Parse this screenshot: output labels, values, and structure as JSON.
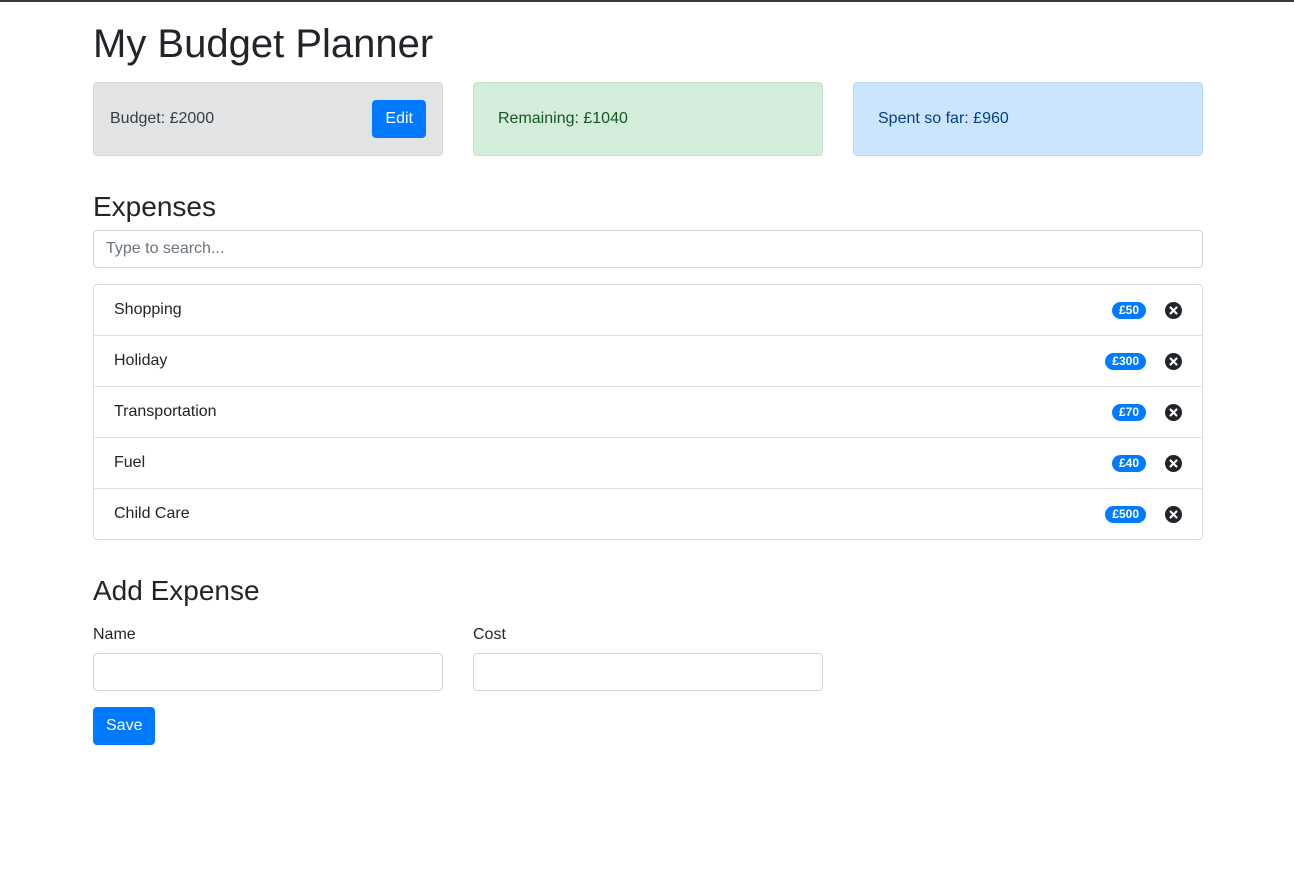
{
  "page_title": "My Budget Planner",
  "budget": {
    "label": "Budget: £2000",
    "edit_label": "Edit"
  },
  "remaining": {
    "label": "Remaining: £1040"
  },
  "spent": {
    "label": "Spent so far: £960"
  },
  "expenses": {
    "heading": "Expenses",
    "search_placeholder": "Type to search...",
    "items": [
      {
        "name": "Shopping",
        "cost": "£50"
      },
      {
        "name": "Holiday",
        "cost": "£300"
      },
      {
        "name": "Transportation",
        "cost": "£70"
      },
      {
        "name": "Fuel",
        "cost": "£40"
      },
      {
        "name": "Child Care",
        "cost": "£500"
      }
    ],
    "delete_icon": "times-circle-icon"
  },
  "add_expense": {
    "heading": "Add Expense",
    "name_label": "Name",
    "name_value": "",
    "cost_label": "Cost",
    "cost_value": "",
    "save_label": "Save"
  },
  "colors": {
    "primary": "#007bff",
    "budget_card": "#e2e3e5",
    "remaining_card": "#d4edda",
    "spent_card": "#cce5ff"
  }
}
